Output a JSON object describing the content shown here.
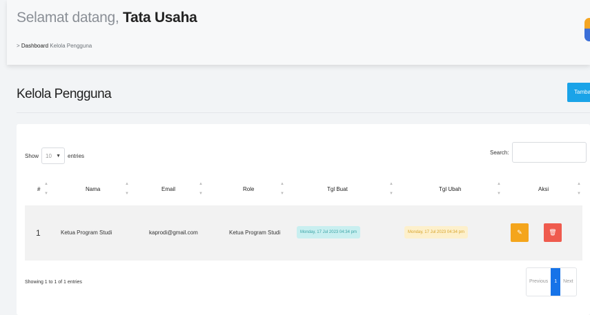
{
  "header": {
    "welcome_prefix": "Selamat datang,",
    "welcome_user": "Tata Usaha",
    "breadcrumb_arrow": ">",
    "breadcrumb_root": "Dashboard",
    "breadcrumb_current": "Kelola Pengguna"
  },
  "page": {
    "title": "Kelola Pengguna",
    "add_button": "Tambah"
  },
  "table_controls": {
    "show_label": "Show",
    "entries_value": "10",
    "entries_label": "entries",
    "search_label": "Search:"
  },
  "table": {
    "columns": [
      "#",
      "Nama",
      "Email",
      "Role",
      "Tgl Buat",
      "Tgl Ubah",
      "Aksi"
    ],
    "rows": [
      {
        "no": "1",
        "nama": "Ketua Program Studi",
        "email": "kaprodi@gmail.com",
        "role": "Ketua Program Studi",
        "tgl_buat": "Monday, 17 Jul 2023 04:34 pm",
        "tgl_ubah": "Monday, 17 Jul 2023 04:34 pm",
        "edit_icon": "✎",
        "delete_icon": "🗑"
      }
    ]
  },
  "footer": {
    "info": "Showing 1 to 1 of 1 entries",
    "prev": "Previous",
    "page": "1",
    "next": "Next"
  },
  "colors": {
    "accent": "#1aa3e8",
    "edit": "#f4a51c",
    "delete": "#ef5b4e",
    "page_active": "#1673e8"
  }
}
